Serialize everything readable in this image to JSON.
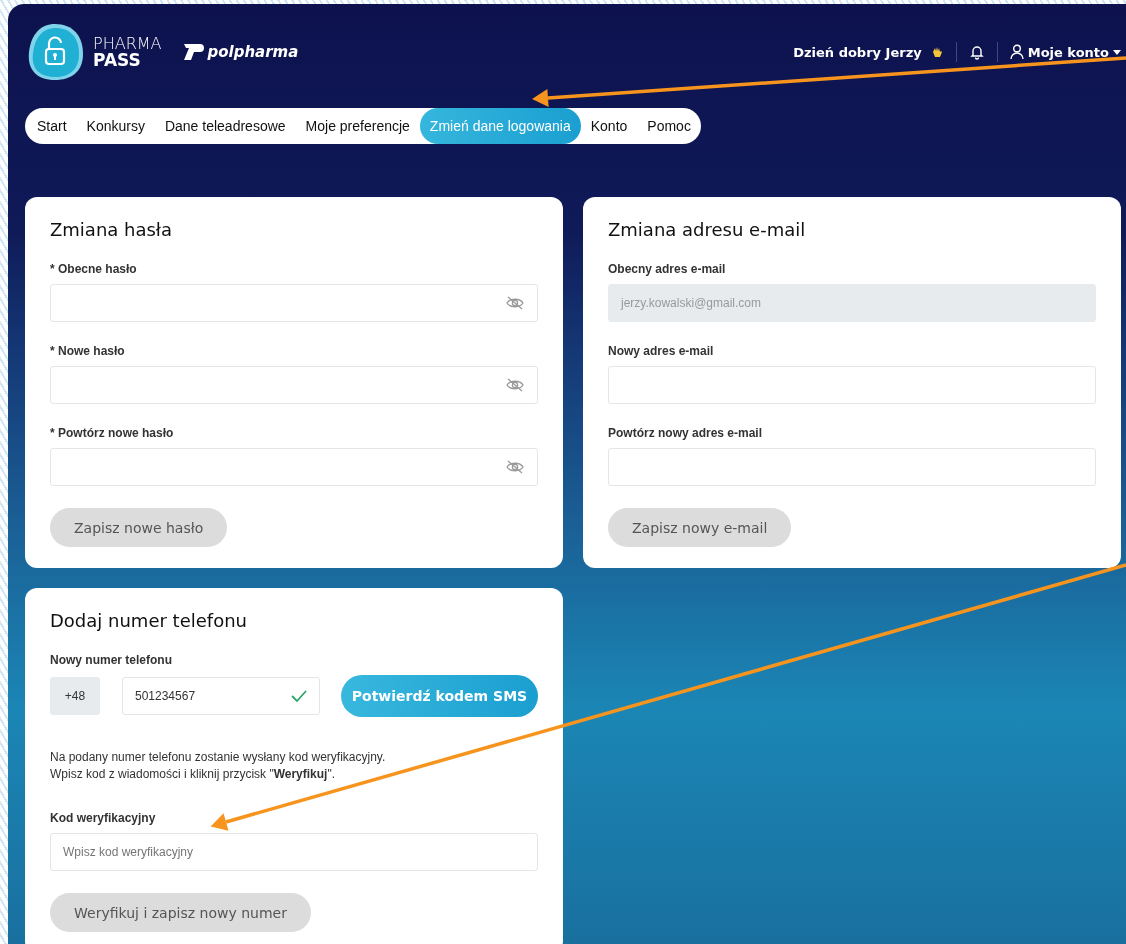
{
  "header": {
    "brand_line1": "PHARMA",
    "brand_line2": "PASS",
    "partner": "polpharma",
    "greeting": "Dzień dobry Jerzy",
    "account": "Moje konto"
  },
  "tabs": [
    {
      "label": "Start",
      "selected": false
    },
    {
      "label": "Konkursy",
      "selected": false
    },
    {
      "label": "Dane teleadresowe",
      "selected": false
    },
    {
      "label": "Moje preferencje",
      "selected": false
    },
    {
      "label": "Zmień dane logowania",
      "selected": true
    },
    {
      "label": "Konto",
      "selected": false
    },
    {
      "label": "Pomoc",
      "selected": false
    }
  ],
  "password_card": {
    "title": "Zmiana hasła",
    "fields": [
      {
        "label": "* Obecne hasło",
        "kind": "password"
      },
      {
        "label": "* Nowe hasło",
        "kind": "password"
      },
      {
        "label": "* Powtórz nowe hasło",
        "kind": "password"
      }
    ],
    "button": {
      "label": "Zapisz nowe hasło",
      "disabled": true
    }
  },
  "email_card": {
    "title": "Zmiana adresu e-mail",
    "fields": [
      {
        "label": "Obecny adres e-mail",
        "kind": "readonly",
        "value": "jerzy.kowalski@gmail.com"
      },
      {
        "label": "Nowy adres e-mail",
        "kind": "text"
      },
      {
        "label": "Powtórz nowy adres e-mail",
        "kind": "text"
      }
    ],
    "button": {
      "label": "Zapisz nowy e-mail",
      "disabled": true
    }
  },
  "phone_card": {
    "title": "Dodaj numer telefonu",
    "phone_label": "Nowy numer telefonu",
    "prefix": "+48",
    "number": "501234567",
    "valid": true,
    "sms_button": {
      "label": "Potwierdź kodem SMS",
      "disabled": false
    },
    "info": [
      "Na podany numer telefonu zostanie wysłany kod weryfikacyjny.",
      "Wpisz kod z wiadomości i kliknij przycisk \"**Weryfikuj**\"."
    ],
    "code_label": "Kod weryfikacyjny",
    "code_placeholder": "Wpisz kod weryfikacyjny",
    "button": {
      "label": "Weryfikuj i zapisz nowy numer",
      "disabled": true
    }
  },
  "annotations": [
    {
      "kind": "arrow"
    },
    {
      "kind": "arrow"
    }
  ]
}
